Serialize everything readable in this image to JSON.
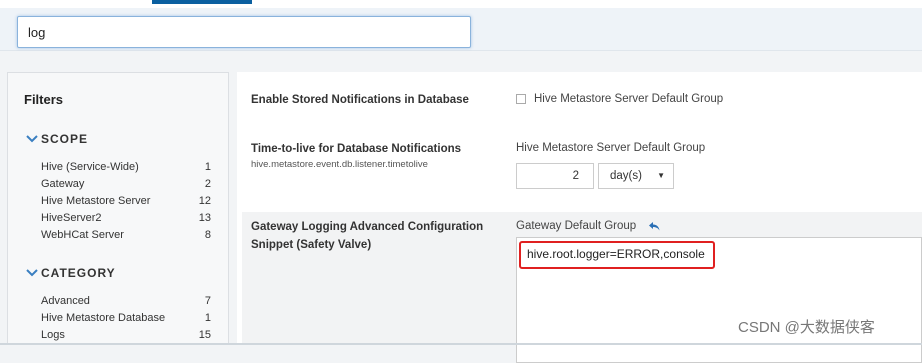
{
  "search": {
    "value": "log"
  },
  "sidebar": {
    "title": "Filters",
    "scope": {
      "title": "SCOPE",
      "items": [
        {
          "label": "Hive (Service-Wide)",
          "count": "1"
        },
        {
          "label": "Gateway",
          "count": "2"
        },
        {
          "label": "Hive Metastore Server",
          "count": "12"
        },
        {
          "label": "HiveServer2",
          "count": "13"
        },
        {
          "label": "WebHCat Server",
          "count": "8"
        }
      ]
    },
    "category": {
      "title": "CATEGORY",
      "items": [
        {
          "label": "Advanced",
          "count": "7"
        },
        {
          "label": "Hive Metastore Database",
          "count": "1"
        },
        {
          "label": "Logs",
          "count": "15"
        }
      ]
    }
  },
  "settings": [
    {
      "label": "Enable Stored Notifications in Database",
      "group": "Hive Metastore Server Default Group"
    },
    {
      "label": "Time-to-live for Database Notifications",
      "property": "hive.metastore.event.db.listener.timetolive",
      "group": "Hive Metastore Server Default Group",
      "value": "2",
      "unit": "day(s)"
    },
    {
      "label_line1": "Gateway Logging Advanced Configuration",
      "label_line2": "Snippet (Safety Valve)",
      "group": "Gateway Default Group",
      "value": "hive.root.logger=ERROR,console"
    }
  ],
  "watermark": "CSDN @大数据侠客",
  "colors": {
    "accent": "#0a5fa0",
    "highlight": "#e02020"
  },
  "icons": [
    "chevron-down-icon",
    "undo-icon",
    "dropdown-arrow-icon"
  ]
}
